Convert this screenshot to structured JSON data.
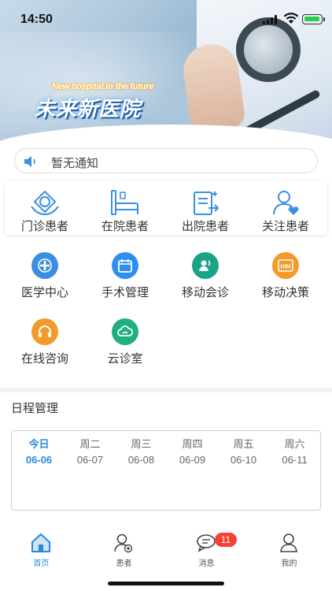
{
  "status_bar": {
    "time": "14:50"
  },
  "banner": {
    "slogan_en": "New hospital in the future",
    "slogan_cn": "未来新医院"
  },
  "notice": {
    "text": "暂无通知",
    "icon": "speaker-icon"
  },
  "patient_categories": [
    {
      "label": "门诊患者",
      "icon": "outpatient-icon"
    },
    {
      "label": "在院患者",
      "icon": "inpatient-bed-icon"
    },
    {
      "label": "出院患者",
      "icon": "discharge-icon"
    },
    {
      "label": "关注患者",
      "icon": "followed-patient-icon"
    }
  ],
  "functions": [
    {
      "label": "医学中心",
      "icon": "medical-center-icon",
      "color": "#3b8fe0"
    },
    {
      "label": "手术管理",
      "icon": "surgery-calendar-icon",
      "color": "#2f8ff0"
    },
    {
      "label": "移动会诊",
      "icon": "consultation-icon",
      "color": "#1aa387"
    },
    {
      "label": "移动决策",
      "icon": "hbi-decision-icon",
      "color": "#f39a2b"
    },
    {
      "label": "在线咨询",
      "icon": "headset-icon",
      "color": "#f39a2b"
    },
    {
      "label": "云诊室",
      "icon": "cloud-clinic-icon",
      "color": "#1fb07d"
    }
  ],
  "schedule": {
    "title": "日程管理",
    "days": [
      {
        "weekday": "今日",
        "date": "06-06",
        "active": true
      },
      {
        "weekday": "周二",
        "date": "06-07",
        "active": false
      },
      {
        "weekday": "周三",
        "date": "06-08",
        "active": false
      },
      {
        "weekday": "周四",
        "date": "06-09",
        "active": false
      },
      {
        "weekday": "周五",
        "date": "06-10",
        "active": false
      },
      {
        "weekday": "周六",
        "date": "06-11",
        "active": false
      }
    ]
  },
  "tabbar": {
    "items": [
      {
        "label": "首页",
        "icon": "home-icon",
        "active": true
      },
      {
        "label": "患者",
        "icon": "patient-icon",
        "active": false
      },
      {
        "label": "消息",
        "icon": "message-icon",
        "active": false
      },
      {
        "label": "我的",
        "icon": "profile-icon",
        "active": false
      }
    ],
    "message_badge": "11"
  },
  "colors": {
    "accent": "#2a88de",
    "badge": "#f44336"
  }
}
